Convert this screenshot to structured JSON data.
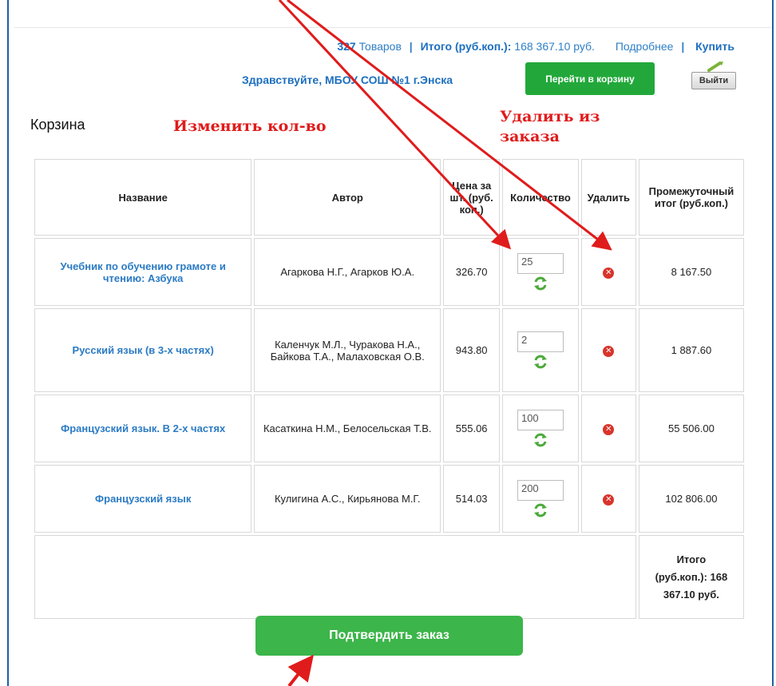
{
  "header": {
    "count": "327",
    "count_label": "Товаров",
    "sep": "|",
    "total_label": "Итого (руб.коп.):",
    "total_value": "168 367.10 руб.",
    "details_link": "Подробнее",
    "buy_link": "Купить",
    "greeting": "Здравствуйте, МБОУ СОШ №1 г.Энска",
    "go_cart_button": "Перейти в корзину",
    "logout_button": "Выйти"
  },
  "page_title": "Корзина",
  "annotations": {
    "change_qty": "Изменить кол-во",
    "remove_from_order": "Удалить из заказа"
  },
  "table": {
    "headers": [
      "Название",
      "Автор",
      "Цена за шт. (руб. коп.)",
      "Количество",
      "Удалить",
      "Промежуточный итог (руб.коп.)"
    ],
    "rows": [
      {
        "name": "Учебник по обучению грамоте и чтению: Азбука",
        "author": "Агаркова Н.Г., Агарков Ю.А.",
        "price": "326.70",
        "qty": "25",
        "subtotal": "8 167.50"
      },
      {
        "name": "Русский язык (в 3-х частях)",
        "author": "Каленчук М.Л., Чуракова Н.А., Байкова Т.А., Малаховская О.В.",
        "price": "943.80",
        "qty": "2",
        "subtotal": "1 887.60"
      },
      {
        "name": "Французский язык. В 2-х частях",
        "author": "Касаткина Н.М., Белосельская Т.В.",
        "price": "555.06",
        "qty": "100",
        "subtotal": "55 506.00"
      },
      {
        "name": "Французский язык",
        "author": "Кулигина А.С., Кирьянова М.Г.",
        "price": "514.03",
        "qty": "200",
        "subtotal": "102 806.00"
      }
    ],
    "total_line1": "Итого",
    "total_line2": "(руб.коп.): 168",
    "total_line3": "367.10 руб."
  },
  "confirm_button": "Подтвердить заказ",
  "colors": {
    "link": "#2b7bc4",
    "green_button": "#22a83a",
    "confirm_button": "#3cb54a",
    "annotation": "#e01b1b",
    "delete_icon": "#d9342b"
  },
  "icons": {
    "delete": "delete-x-icon",
    "refresh": "refresh-arrows-icon",
    "logout": "logout-icon"
  }
}
